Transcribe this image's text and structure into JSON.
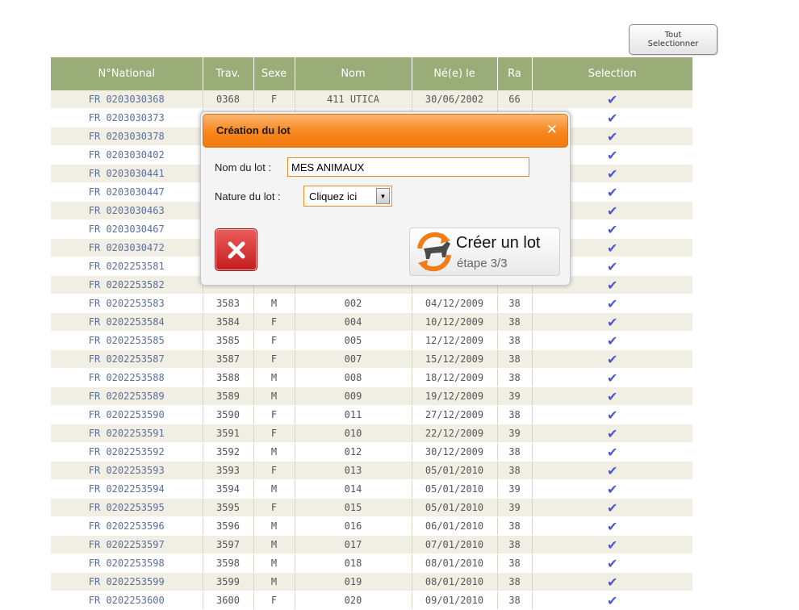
{
  "toolbar": {
    "select_all_line1": "Tout",
    "select_all_line2": "Selectionner"
  },
  "table": {
    "columns": [
      "N°National",
      "Trav.",
      "Sexe",
      "Nom",
      "Né(e) le",
      "Ra",
      "Selection"
    ],
    "selection_mark": "✔",
    "rows": [
      [
        "FR 0203030368",
        "0368",
        "F",
        "411 UTICA",
        "30/06/2002",
        "66"
      ],
      [
        "FR 0203030373",
        "",
        "",
        "",
        "",
        ""
      ],
      [
        "FR 0203030378",
        "",
        "",
        "",
        "",
        ""
      ],
      [
        "FR 0203030402",
        "",
        "",
        "",
        "",
        ""
      ],
      [
        "FR 0203030441",
        "",
        "",
        "",
        "",
        ""
      ],
      [
        "FR 0203030447",
        "",
        "",
        "",
        "",
        ""
      ],
      [
        "FR 0203030463",
        "",
        "",
        "",
        "",
        ""
      ],
      [
        "FR 0203030467",
        "",
        "",
        "",
        "",
        ""
      ],
      [
        "FR 0203030472",
        "",
        "",
        "",
        "",
        ""
      ],
      [
        "FR 0202253581",
        "",
        "",
        "",
        "",
        ""
      ],
      [
        "FR 0202253582",
        "",
        "",
        "",
        "",
        ""
      ],
      [
        "FR 0202253583",
        "3583",
        "M",
        "002",
        "04/12/2009",
        "38"
      ],
      [
        "FR 0202253584",
        "3584",
        "F",
        "004",
        "10/12/2009",
        "38"
      ],
      [
        "FR 0202253585",
        "3585",
        "F",
        "005",
        "12/12/2009",
        "38"
      ],
      [
        "FR 0202253587",
        "3587",
        "F",
        "007",
        "15/12/2009",
        "38"
      ],
      [
        "FR 0202253588",
        "3588",
        "M",
        "008",
        "18/12/2009",
        "38"
      ],
      [
        "FR 0202253589",
        "3589",
        "M",
        "009",
        "19/12/2009",
        "39"
      ],
      [
        "FR 0202253590",
        "3590",
        "F",
        "011",
        "27/12/2009",
        "38"
      ],
      [
        "FR 0202253591",
        "3591",
        "F",
        "010",
        "22/12/2009",
        "39"
      ],
      [
        "FR 0202253592",
        "3592",
        "M",
        "012",
        "30/12/2009",
        "38"
      ],
      [
        "FR 0202253593",
        "3593",
        "F",
        "013",
        "05/01/2010",
        "38"
      ],
      [
        "FR 0202253594",
        "3594",
        "M",
        "014",
        "05/01/2010",
        "39"
      ],
      [
        "FR 0202253595",
        "3595",
        "F",
        "015",
        "05/01/2010",
        "39"
      ],
      [
        "FR 0202253596",
        "3596",
        "M",
        "016",
        "06/01/2010",
        "38"
      ],
      [
        "FR 0202253597",
        "3597",
        "M",
        "017",
        "07/01/2010",
        "38"
      ],
      [
        "FR 0202253598",
        "3598",
        "M",
        "018",
        "08/01/2010",
        "38"
      ],
      [
        "FR 0202253599",
        "3599",
        "M",
        "019",
        "08/01/2010",
        "38"
      ],
      [
        "FR 0202253600",
        "3600",
        "F",
        "020",
        "09/01/2010",
        "38"
      ]
    ]
  },
  "dialog": {
    "title": "Création du lot",
    "close_icon": "close-icon",
    "name_label": "Nom du lot :",
    "name_value": "MES ANIMAUX",
    "nature_label": "Nature du lot :",
    "nature_value": "Cliquez ici",
    "create_label": "Créer un lot",
    "step_label": "étape 3/3"
  },
  "colors": {
    "header_green": "#9aad78",
    "dialog_orange": "#f7861c",
    "check_blue": "#4b55d6",
    "cancel_red": "#c41d1d"
  }
}
